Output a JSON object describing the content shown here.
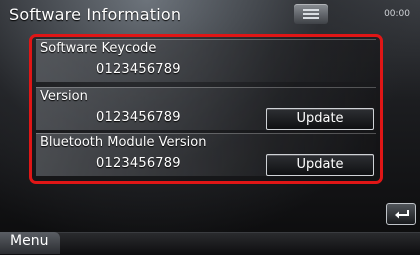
{
  "header": {
    "title": "Software Information",
    "time": "00:00"
  },
  "sections": [
    {
      "label": "Software Keycode",
      "value": "0123456789"
    },
    {
      "label": "Version",
      "value": "0123456789",
      "button": "Update"
    },
    {
      "label": "Bluetooth Module Version",
      "value": "0123456789",
      "button": "Update"
    }
  ],
  "footer": {
    "menu_label": "Menu"
  },
  "icons": {
    "list": "list-icon",
    "back": "back-arrow-icon"
  },
  "colors": {
    "highlight_border": "#e01616"
  }
}
